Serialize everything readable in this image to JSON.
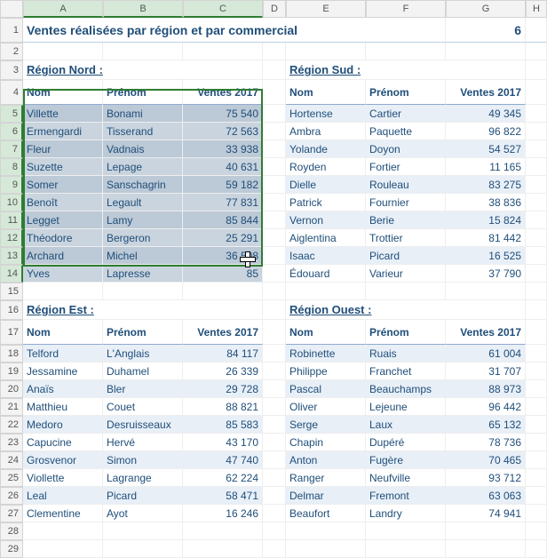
{
  "columns": [
    "A",
    "B",
    "C",
    "D",
    "E",
    "F",
    "G",
    "H"
  ],
  "title": "Ventes réalisées par région et par commercial",
  "title_count": "6",
  "headers": {
    "nom": "Nom",
    "prenom": "Prénom",
    "ventes": "Ventes 2017"
  },
  "regions": {
    "nord": {
      "title": "Région Nord :",
      "rows": [
        {
          "nom": "Villette",
          "prenom": "Bonami",
          "v": "75 540"
        },
        {
          "nom": "Ermengardi",
          "prenom": "Tisserand",
          "v": "72 563"
        },
        {
          "nom": "Fleur",
          "prenom": "Vadnais",
          "v": "33 938"
        },
        {
          "nom": "Suzette",
          "prenom": "Lepage",
          "v": "40 631"
        },
        {
          "nom": "Somer",
          "prenom": "Sanschagrin",
          "v": "59 182"
        },
        {
          "nom": "Benoît",
          "prenom": "Legault",
          "v": "77 831"
        },
        {
          "nom": "Legget",
          "prenom": "Lamy",
          "v": "85 844"
        },
        {
          "nom": "Théodore",
          "prenom": "Bergeron",
          "v": "25 291"
        },
        {
          "nom": "Archard",
          "prenom": "Michel",
          "v": "36 508"
        },
        {
          "nom": "Yves",
          "prenom": "Lapresse",
          "v": "85"
        }
      ]
    },
    "sud": {
      "title": "Région Sud :",
      "rows": [
        {
          "nom": "Hortense",
          "prenom": "Cartier",
          "v": "49 345"
        },
        {
          "nom": "Ambra",
          "prenom": "Paquette",
          "v": "96 822"
        },
        {
          "nom": "Yolande",
          "prenom": "Doyon",
          "v": "54 527"
        },
        {
          "nom": "Royden",
          "prenom": "Fortier",
          "v": "11 165"
        },
        {
          "nom": "Dielle",
          "prenom": "Rouleau",
          "v": "83 275"
        },
        {
          "nom": "Patrick",
          "prenom": "Fournier",
          "v": "38 836"
        },
        {
          "nom": "Vernon",
          "prenom": "Berie",
          "v": "15 824"
        },
        {
          "nom": "Aiglentina",
          "prenom": "Trottier",
          "v": "81 442"
        },
        {
          "nom": "Isaac",
          "prenom": "Picard",
          "v": "16 525"
        },
        {
          "nom": "Édouard",
          "prenom": "Varieur",
          "v": "37 790"
        }
      ]
    },
    "est": {
      "title": "Région Est :",
      "rows": [
        {
          "nom": "Telford",
          "prenom": "L'Anglais",
          "v": "84 117"
        },
        {
          "nom": "Jessamine",
          "prenom": "Duhamel",
          "v": "26 339"
        },
        {
          "nom": "Anaïs",
          "prenom": "Bler",
          "v": "29 728"
        },
        {
          "nom": "Matthieu",
          "prenom": "Couet",
          "v": "88 821"
        },
        {
          "nom": "Medoro",
          "prenom": "Desruisseaux",
          "v": "85 583"
        },
        {
          "nom": "Capucine",
          "prenom": "Hervé",
          "v": "43 170"
        },
        {
          "nom": "Grosvenor",
          "prenom": "Simon",
          "v": "47 740"
        },
        {
          "nom": "Viollette",
          "prenom": "Lagrange",
          "v": "62 224"
        },
        {
          "nom": "Leal",
          "prenom": "Picard",
          "v": "58 471"
        },
        {
          "nom": "Clementine",
          "prenom": "Ayot",
          "v": "16 246"
        }
      ]
    },
    "ouest": {
      "title": "Région Ouest :",
      "rows": [
        {
          "nom": "Robinette",
          "prenom": "Ruais",
          "v": "61 004"
        },
        {
          "nom": "Philippe",
          "prenom": "Franchet",
          "v": "31 707"
        },
        {
          "nom": "Pascal",
          "prenom": "Beauchamps",
          "v": "88 973"
        },
        {
          "nom": "Oliver",
          "prenom": "Lejeune",
          "v": "96 442"
        },
        {
          "nom": "Serge",
          "prenom": "Laux",
          "v": "65 132"
        },
        {
          "nom": "Chapin",
          "prenom": "Dupéré",
          "v": "78 736"
        },
        {
          "nom": "Anton",
          "prenom": "Fugère",
          "v": "70 465"
        },
        {
          "nom": "Ranger",
          "prenom": "Neufville",
          "v": "93 712"
        },
        {
          "nom": "Delmar",
          "prenom": "Fremont",
          "v": "63 063"
        },
        {
          "nom": "Beaufort",
          "prenom": "Landry",
          "v": "74 941"
        }
      ]
    }
  }
}
